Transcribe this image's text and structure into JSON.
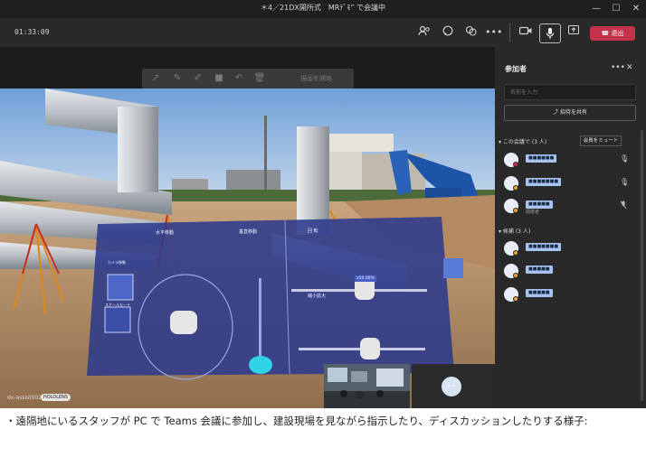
{
  "window": {
    "title": "＊4／21DX開所式　MRﾃﾞﾓ” で会議中"
  },
  "toolbar": {
    "timer": "01:33:09",
    "leave_label": "退出"
  },
  "draw_toolbar": {
    "label": "描画を開始"
  },
  "video": {
    "user_tag": "dx-assist002",
    "device_badge": "HOLOLENS",
    "hologram_labels": {
      "move_mode": "カメラ移動",
      "scale_mode": "スケールモード",
      "pan": "水平移動",
      "vertical": "垂直移動",
      "rotate": "回 転",
      "zoom": "縮小拡大",
      "zoom_value": "x50.00%"
    }
  },
  "panel": {
    "title": "参加者",
    "search_placeholder": "名前を入力",
    "share_invite": "招待を共有",
    "in_meeting_header": "この会議で (3 人)",
    "mute_all": "会員をミュート",
    "others_header": "候補 (3 人)",
    "in_meeting": [
      {
        "name": "■■■■■■",
        "role": "",
        "mic": "on",
        "dot": "#c4314b"
      },
      {
        "name": "■■■■■■■",
        "role": "",
        "mic": "on",
        "dot": "#e8a33d"
      },
      {
        "name": "■■■■■",
        "role": "開催者",
        "mic": "off",
        "dot": "#e8a33d"
      }
    ],
    "others": [
      {
        "name": "■■■■■■■",
        "dot": "#e8a33d"
      },
      {
        "name": "■■■■■",
        "dot": "#e8a33d"
      },
      {
        "name": "■■■■■",
        "dot": "#e8a33d"
      }
    ]
  },
  "caption": "・遠隔地にいるスタッフが PC で Teams 会議に参加し、建設現場を見ながら指示したり、ディスカッションしたりする様子:"
}
